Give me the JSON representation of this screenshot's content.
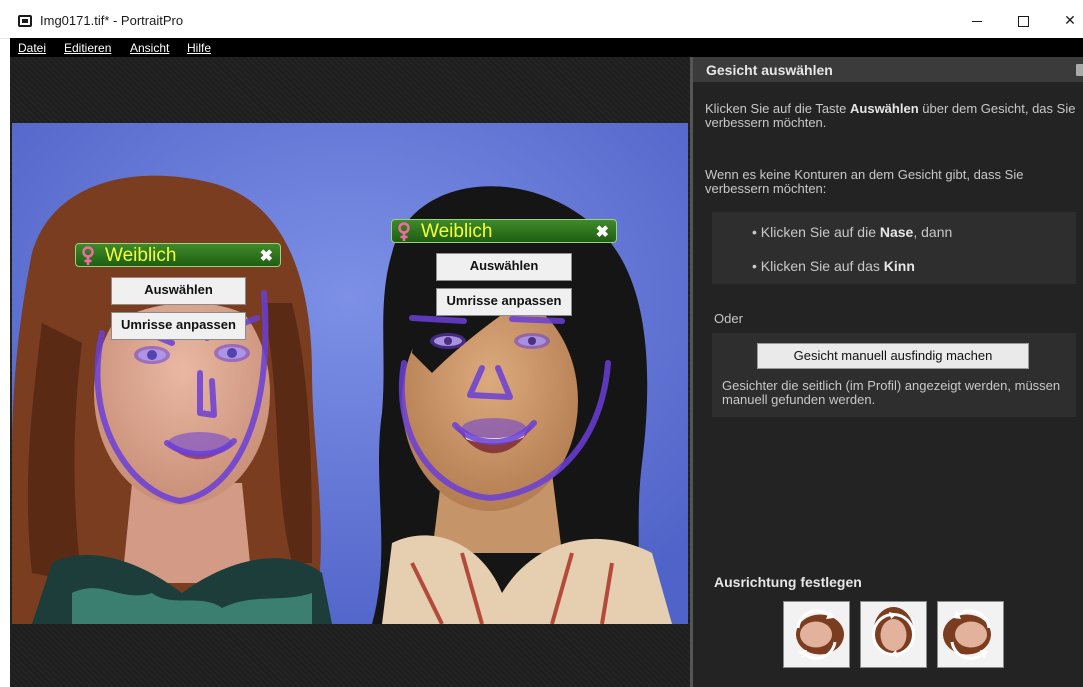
{
  "window": {
    "title": "Img0171.tif* - PortraitPro",
    "controls": {
      "minimize": "minimize-icon",
      "maximize": "maximize-icon",
      "close": "✕"
    }
  },
  "menu": {
    "items": [
      "Datei",
      "Editieren",
      "Ansicht",
      "Hilfe"
    ]
  },
  "faces": [
    {
      "gender": "Weiblich",
      "gender_icon": "female-icon",
      "select_label": "Auswählen",
      "contour_label": "Umrisse anpassen"
    },
    {
      "gender": "Weiblich",
      "gender_icon": "female-icon",
      "select_label": "Auswählen",
      "contour_label": "Umrisse anpassen"
    }
  ],
  "panel": {
    "title": "Gesicht auswählen",
    "intro_prefix": "Klicken Sie auf die Taste ",
    "intro_bold": "Auswählen",
    "intro_suffix": " über dem Gesicht, das Sie verbessern möchten.",
    "no_contours": "Wenn es keine Konturen an dem Gesicht gibt, dass Sie verbessern möchten:",
    "step1_prefix": "Klicken Sie auf die ",
    "step1_bold": "Nase",
    "step1_suffix": ", dann",
    "step2_prefix": "Klicken Sie auf das ",
    "step2_bold": "Kinn",
    "or_label": "Oder",
    "find_button": "Gesicht manuell ausfindig machen",
    "profile_note": "Gesichter die seitlich (im Profil) angezeigt werden, müssen manuell gefunden werden.",
    "orientation_heading": "Ausrichtung festlegen",
    "orientation_buttons": [
      "rotate-left-icon",
      "rotate-180-icon",
      "rotate-right-icon"
    ]
  },
  "colors": {
    "overlay_contour": "#6a3fd8",
    "label_green": "#2e7a1f",
    "label_text": "#f3ff3d",
    "panel_bg": "#232323",
    "backdrop_blue": "#6b7fd6"
  }
}
